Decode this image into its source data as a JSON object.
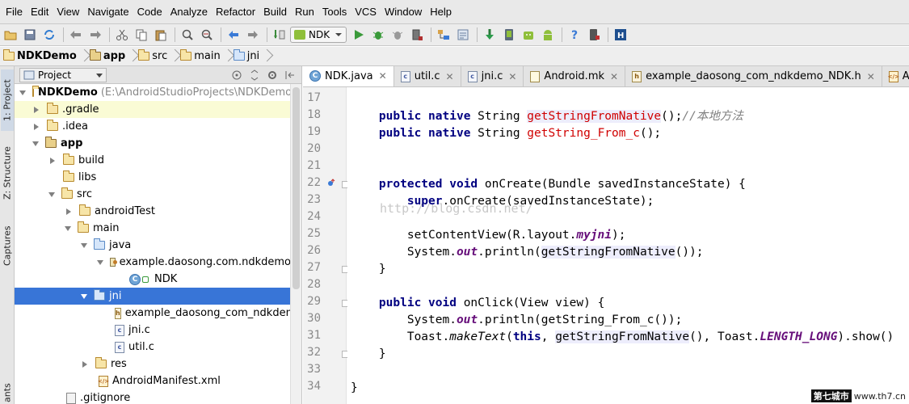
{
  "menu": [
    "File",
    "Edit",
    "View",
    "Navigate",
    "Code",
    "Analyze",
    "Refactor",
    "Build",
    "Run",
    "Tools",
    "VCS",
    "Window",
    "Help"
  ],
  "toolbar": {
    "run_config": "NDK"
  },
  "breadcrumb": [
    "NDKDemo",
    "app",
    "src",
    "main",
    "jni"
  ],
  "side_tabs": {
    "project": "1: Project",
    "structure": "Z: Structure",
    "captures": "Captures",
    "bottom": "ants"
  },
  "project_panel": {
    "view_select": "Project",
    "tree": [
      {
        "label": "NDKDemo",
        "extra": "(E:\\AndroidStudioProjects\\NDKDemo)"
      },
      {
        "label": ".gradle"
      },
      {
        "label": ".idea"
      },
      {
        "label": "app"
      },
      {
        "label": "build"
      },
      {
        "label": "libs"
      },
      {
        "label": "src"
      },
      {
        "label": "androidTest"
      },
      {
        "label": "main"
      },
      {
        "label": "java"
      },
      {
        "label": "example.daosong.com.ndkdemo"
      },
      {
        "label": "NDK"
      },
      {
        "label": "jni"
      },
      {
        "label": "example_daosong_com_ndkdemo_"
      },
      {
        "label": "jni.c"
      },
      {
        "label": "util.c"
      },
      {
        "label": "res"
      },
      {
        "label": "AndroidManifest.xml"
      },
      {
        "label": ".gitignore"
      }
    ]
  },
  "editor_tabs": [
    "NDK.java",
    "util.c",
    "jni.c",
    "Android.mk",
    "example_daosong_com_ndkdemo_NDK.h",
    "AndroidM"
  ],
  "line_numbers": [
    "17",
    "18",
    "19",
    "20",
    "21",
    "22",
    "23",
    "24",
    "25",
    "26",
    "27",
    "28",
    "29",
    "30",
    "31",
    "32",
    "33",
    "34"
  ],
  "code": {
    "public": "public",
    "native": "native",
    "protected": "protected",
    "void": "void",
    "super": "super",
    "this": "this",
    "string": " String ",
    "fn_native": "getStringFromNative",
    "fn_from_c": "getString_From_c",
    "call_end_comment": "();",
    "comment": "//本地方法",
    "on_create_sig": " onCreate(Bundle savedInstanceState) {",
    "super_call": ".onCreate(savedInstanceState);",
    "set_content": "setContentView(R.layout.",
    "myjni": "myjni",
    "paren_semicolon": ");",
    "system": "System.",
    "out": "out",
    "println_open": ".println(",
    "println_close_native": "());",
    "close_brace": "}",
    "on_click_sig": " onClick(View view) {",
    "println_from_c": ".println(getString_From_c());",
    "toast_prefix": "Toast.",
    "make_text": "makeText",
    "toast_open": "(",
    "toast_mid": ", ",
    "toast_after_native": "(), Toast.",
    "length_long": "LENGTH_LONG",
    "show": ").show()"
  },
  "watermark": "http://blog.csdn.net/",
  "corner_logo": {
    "left": "第七城市",
    "right": "www.th7.cn"
  }
}
